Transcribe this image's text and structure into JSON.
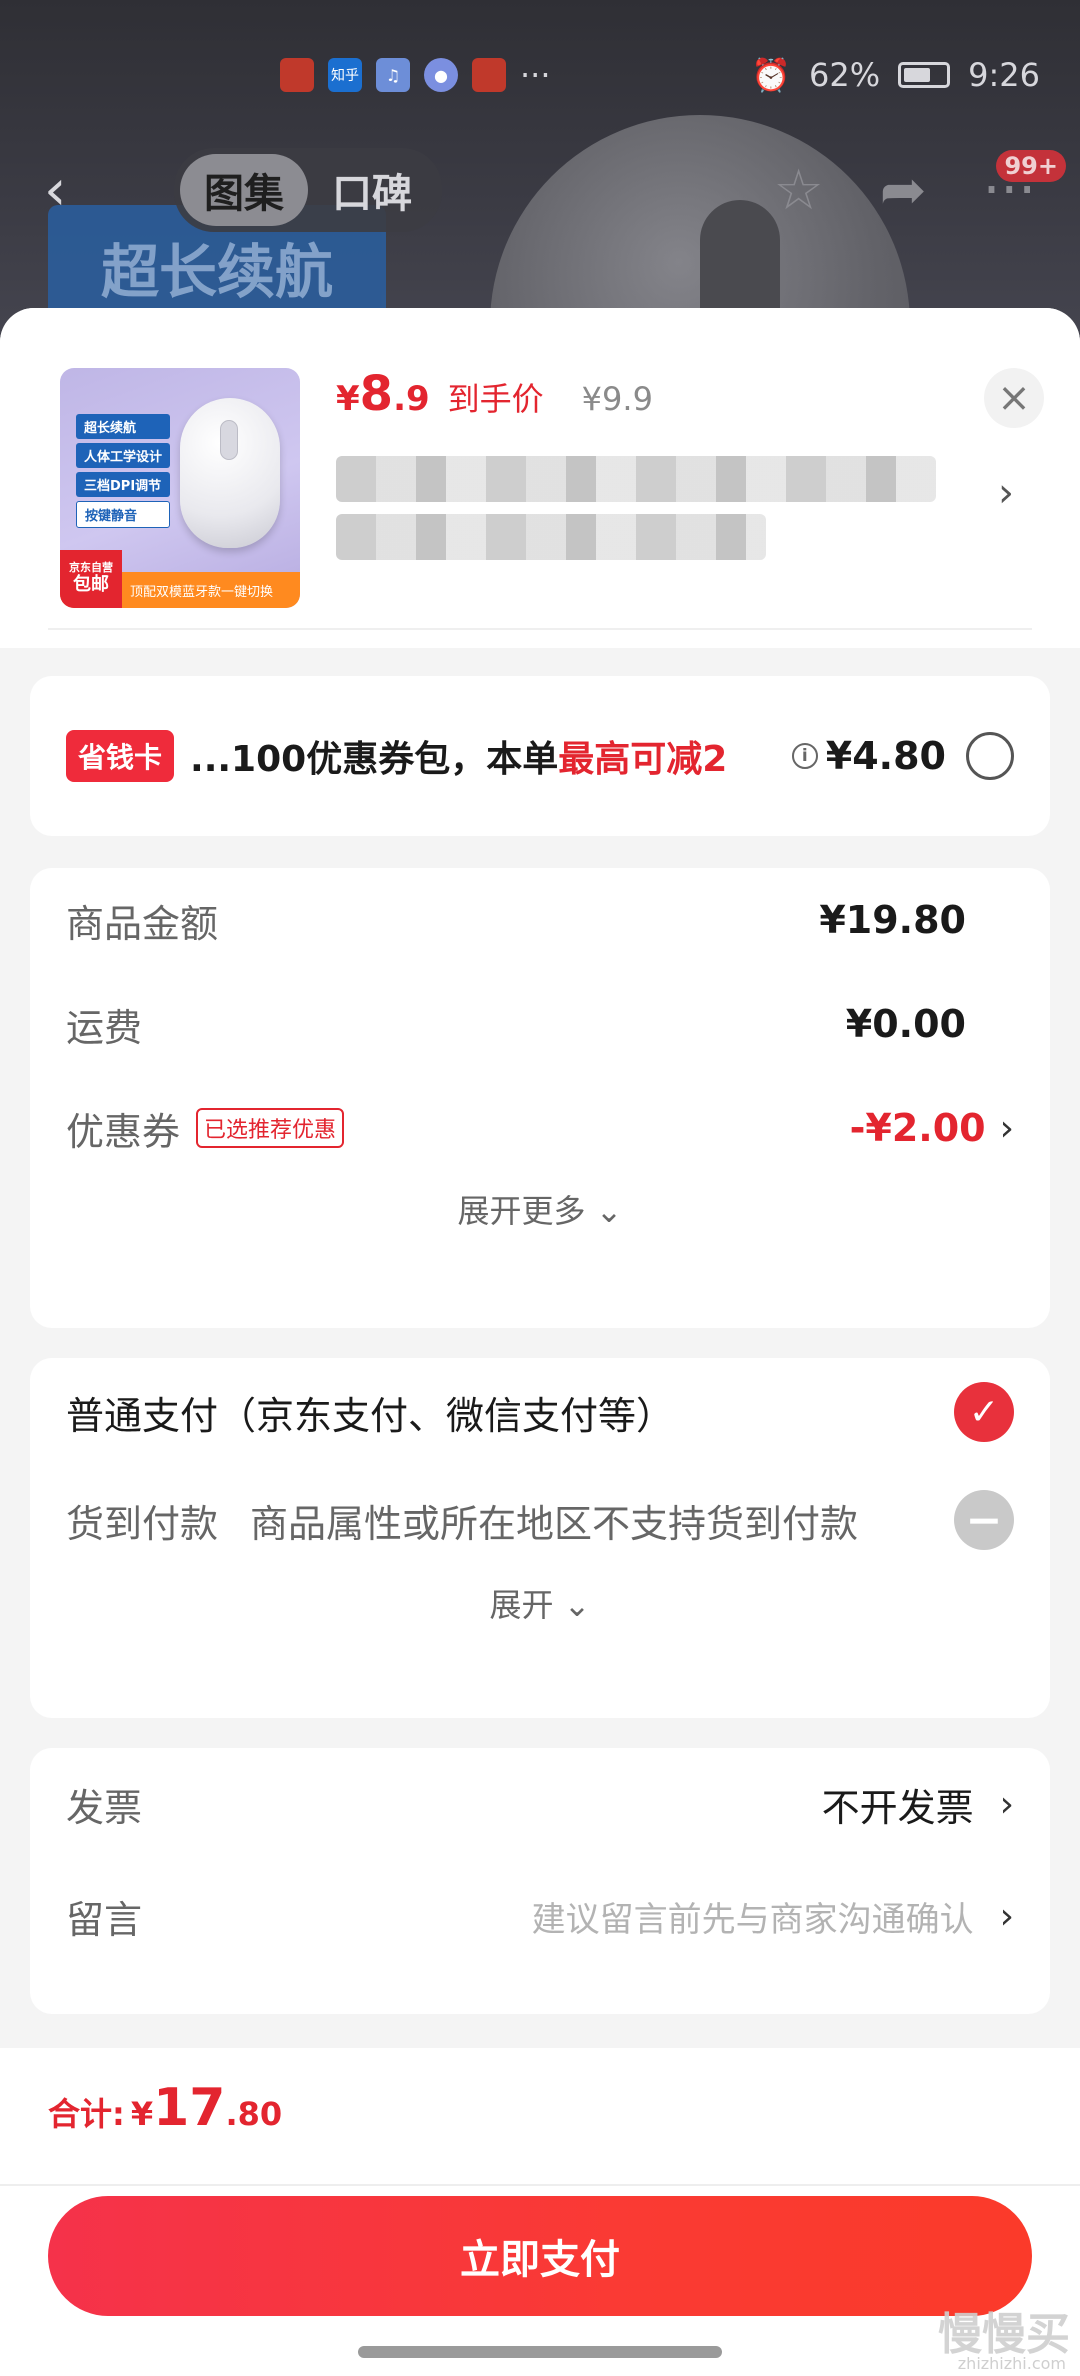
{
  "status_bar": {
    "battery": "62%",
    "time": "9:26",
    "app_icons": [
      "知乎",
      "♫",
      "●"
    ]
  },
  "background_page": {
    "badge_text": "超长续航",
    "tabs": [
      "图集",
      "口碑"
    ],
    "message_badge": "99+"
  },
  "product": {
    "price_currency": "¥",
    "price_int": "8",
    "price_dec": ".9",
    "price_label": "到手价",
    "original_price": "¥9.9",
    "image_tags": [
      "超长续航",
      "人体工学设计",
      "三档DPI调节",
      "按键静音"
    ],
    "image_badge_top": "京东自营",
    "image_badge_bottom": "包邮",
    "image_footer": "顶配双模蓝牙款一键切换"
  },
  "coupon_bar": {
    "badge": "省钱卡",
    "text_prefix": "...100优惠券包，本单",
    "text_highlight": "最高可减2",
    "amount": "¥4.80"
  },
  "amounts": {
    "rows": [
      {
        "label": "商品金额",
        "value": "¥19.80"
      },
      {
        "label": "运费",
        "value": "¥0.00"
      },
      {
        "label": "优惠券",
        "tag": "已选推荐优惠",
        "value": "-¥2.00"
      }
    ],
    "expand_more": "展开更多 ⌄"
  },
  "payment": {
    "standard": "普通支付（京东支付、微信支付等）",
    "cod_label": "货到付款",
    "cod_note": "商品属性或所在地区不支持货到付款",
    "expand": "展开 ⌄"
  },
  "invoice": {
    "label": "发票",
    "value": "不开发票",
    "note_label": "留言",
    "note_placeholder": "建议留言前先与商家沟通确认"
  },
  "footer": {
    "total_label": "合计:",
    "total_currency": "¥",
    "total_int": "17",
    "total_dec": ".80",
    "pay_button": "立即支付",
    "watermark": "慢慢买",
    "watermark_url": "zhizhizhi.com"
  },
  "colors": {
    "accent": "#e3252f",
    "pay_button": "#fa3a33",
    "sheet_bg": "#f4f4f4"
  }
}
